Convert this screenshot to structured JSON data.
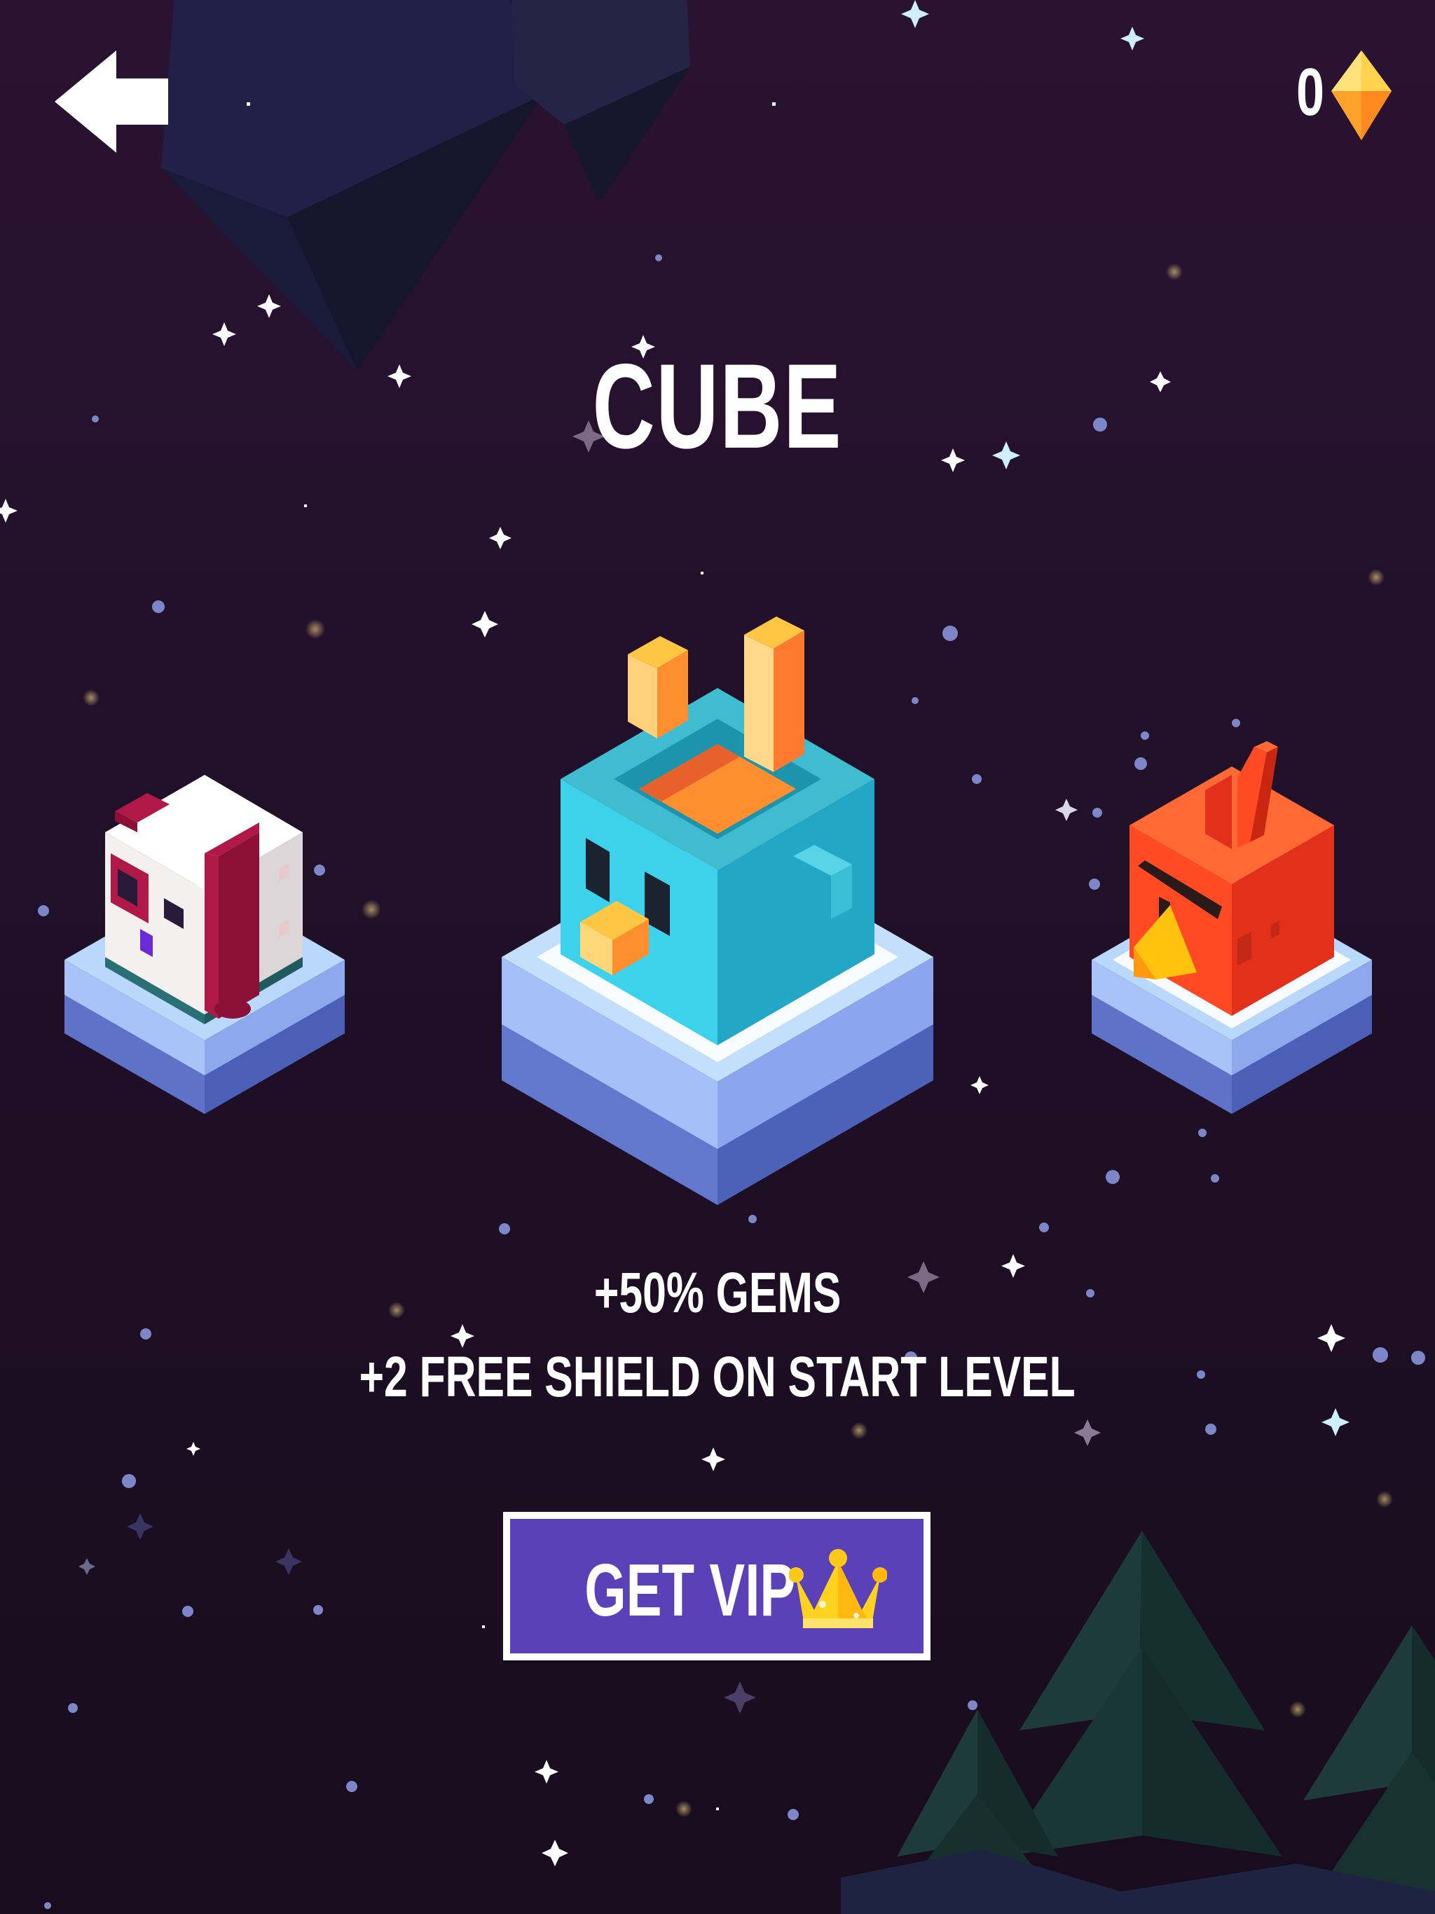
{
  "header": {
    "back_icon": "arrow-left-icon",
    "gem_count": "0",
    "gem_icon": "gem-icon"
  },
  "title": "CUBE",
  "perks": [
    "+50% GEMS",
    "+2 FREE SHIELD ON START LEVEL"
  ],
  "vip_button": {
    "label": "GET VIP",
    "icon": "crown-icon"
  },
  "characters": [
    {
      "id": "chicken",
      "selected": false
    },
    {
      "id": "cube-bird",
      "selected": true
    },
    {
      "id": "angry-bird",
      "selected": false
    }
  ],
  "colors": {
    "background": "#211029",
    "vip_button": "#5a41b8",
    "gem_yellow": "#ffd24a",
    "gem_orange": "#ff9a2e"
  }
}
